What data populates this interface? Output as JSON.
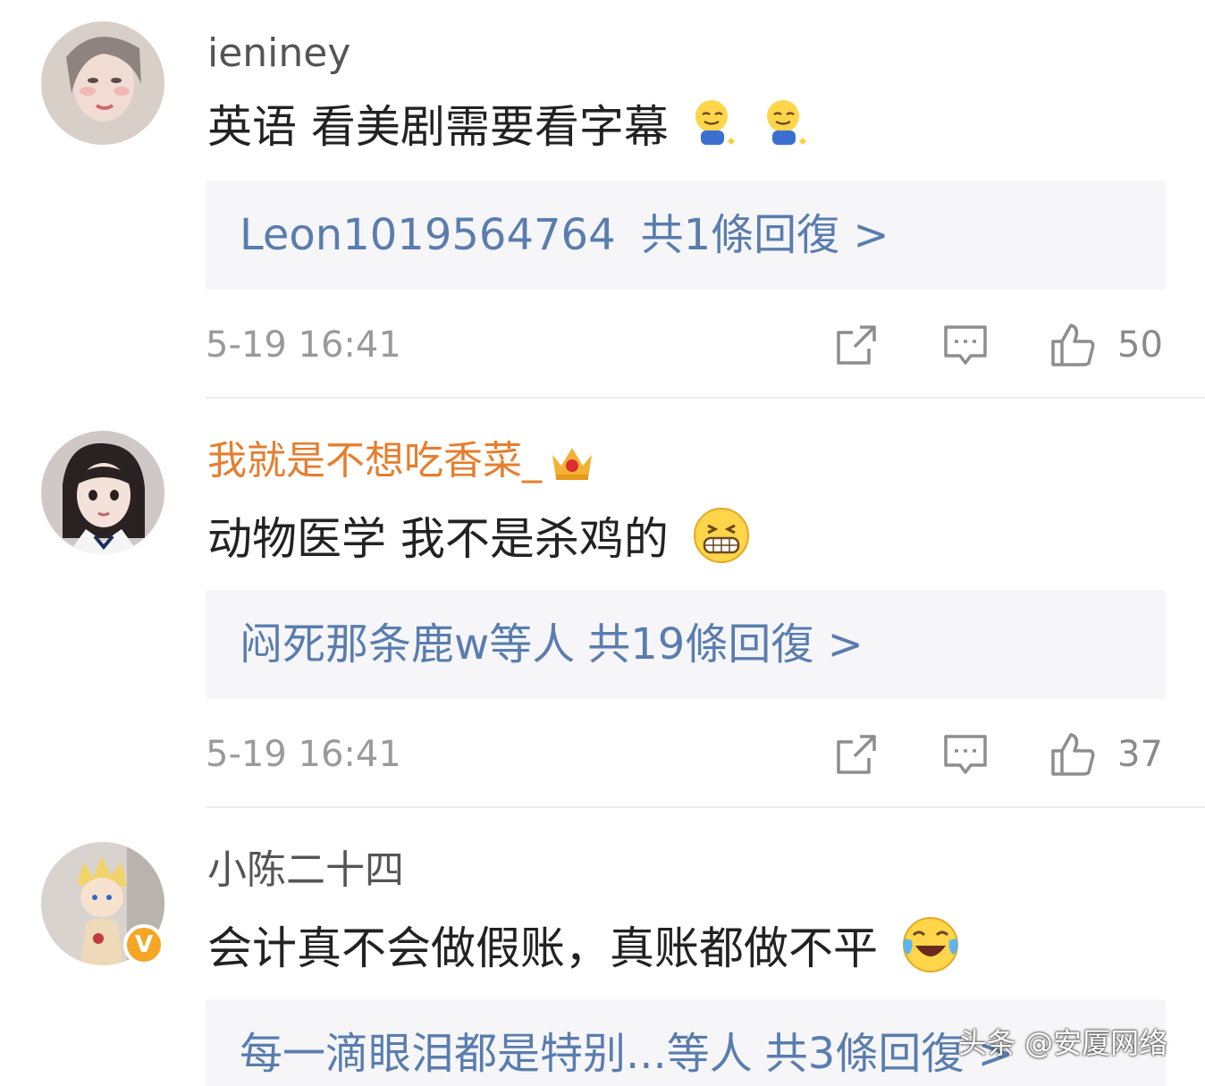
{
  "comments": [
    {
      "username": "ieniney",
      "text": "英语 看美剧需要看字幕",
      "emojis": [
        "sweat-smile-emoji",
        "sweat-smile-emoji"
      ],
      "reply_users": "Leon1019564764",
      "reply_count": "共1條回復 >",
      "time": "5-19 16:41",
      "likes": "50"
    },
    {
      "username": "我就是不想吃香菜_",
      "badge": "crown-icon",
      "text": "动物医学  我不是杀鸡的",
      "emojis": [
        "grin-emoji"
      ],
      "reply_users": "闷死那条鹿w等人",
      "reply_count": "共19條回復 >",
      "time": "5-19 16:41",
      "likes": "37"
    },
    {
      "username": "小陈二十四",
      "verified_badge": "V",
      "text": "会计真不会做假账，真账都做不平",
      "emojis": [
        "laugh-cry-emoji"
      ],
      "reply_users": "每一滴眼泪都是特别...等人",
      "reply_count": "共3條回復 >"
    }
  ],
  "watermark": "头条 @安厦网络",
  "colors": {
    "username_vip": "#e57e2f",
    "reply_link": "#5a7dae",
    "reply_bg": "#f6f6f8",
    "meta_gray": "#9a9a9a"
  }
}
